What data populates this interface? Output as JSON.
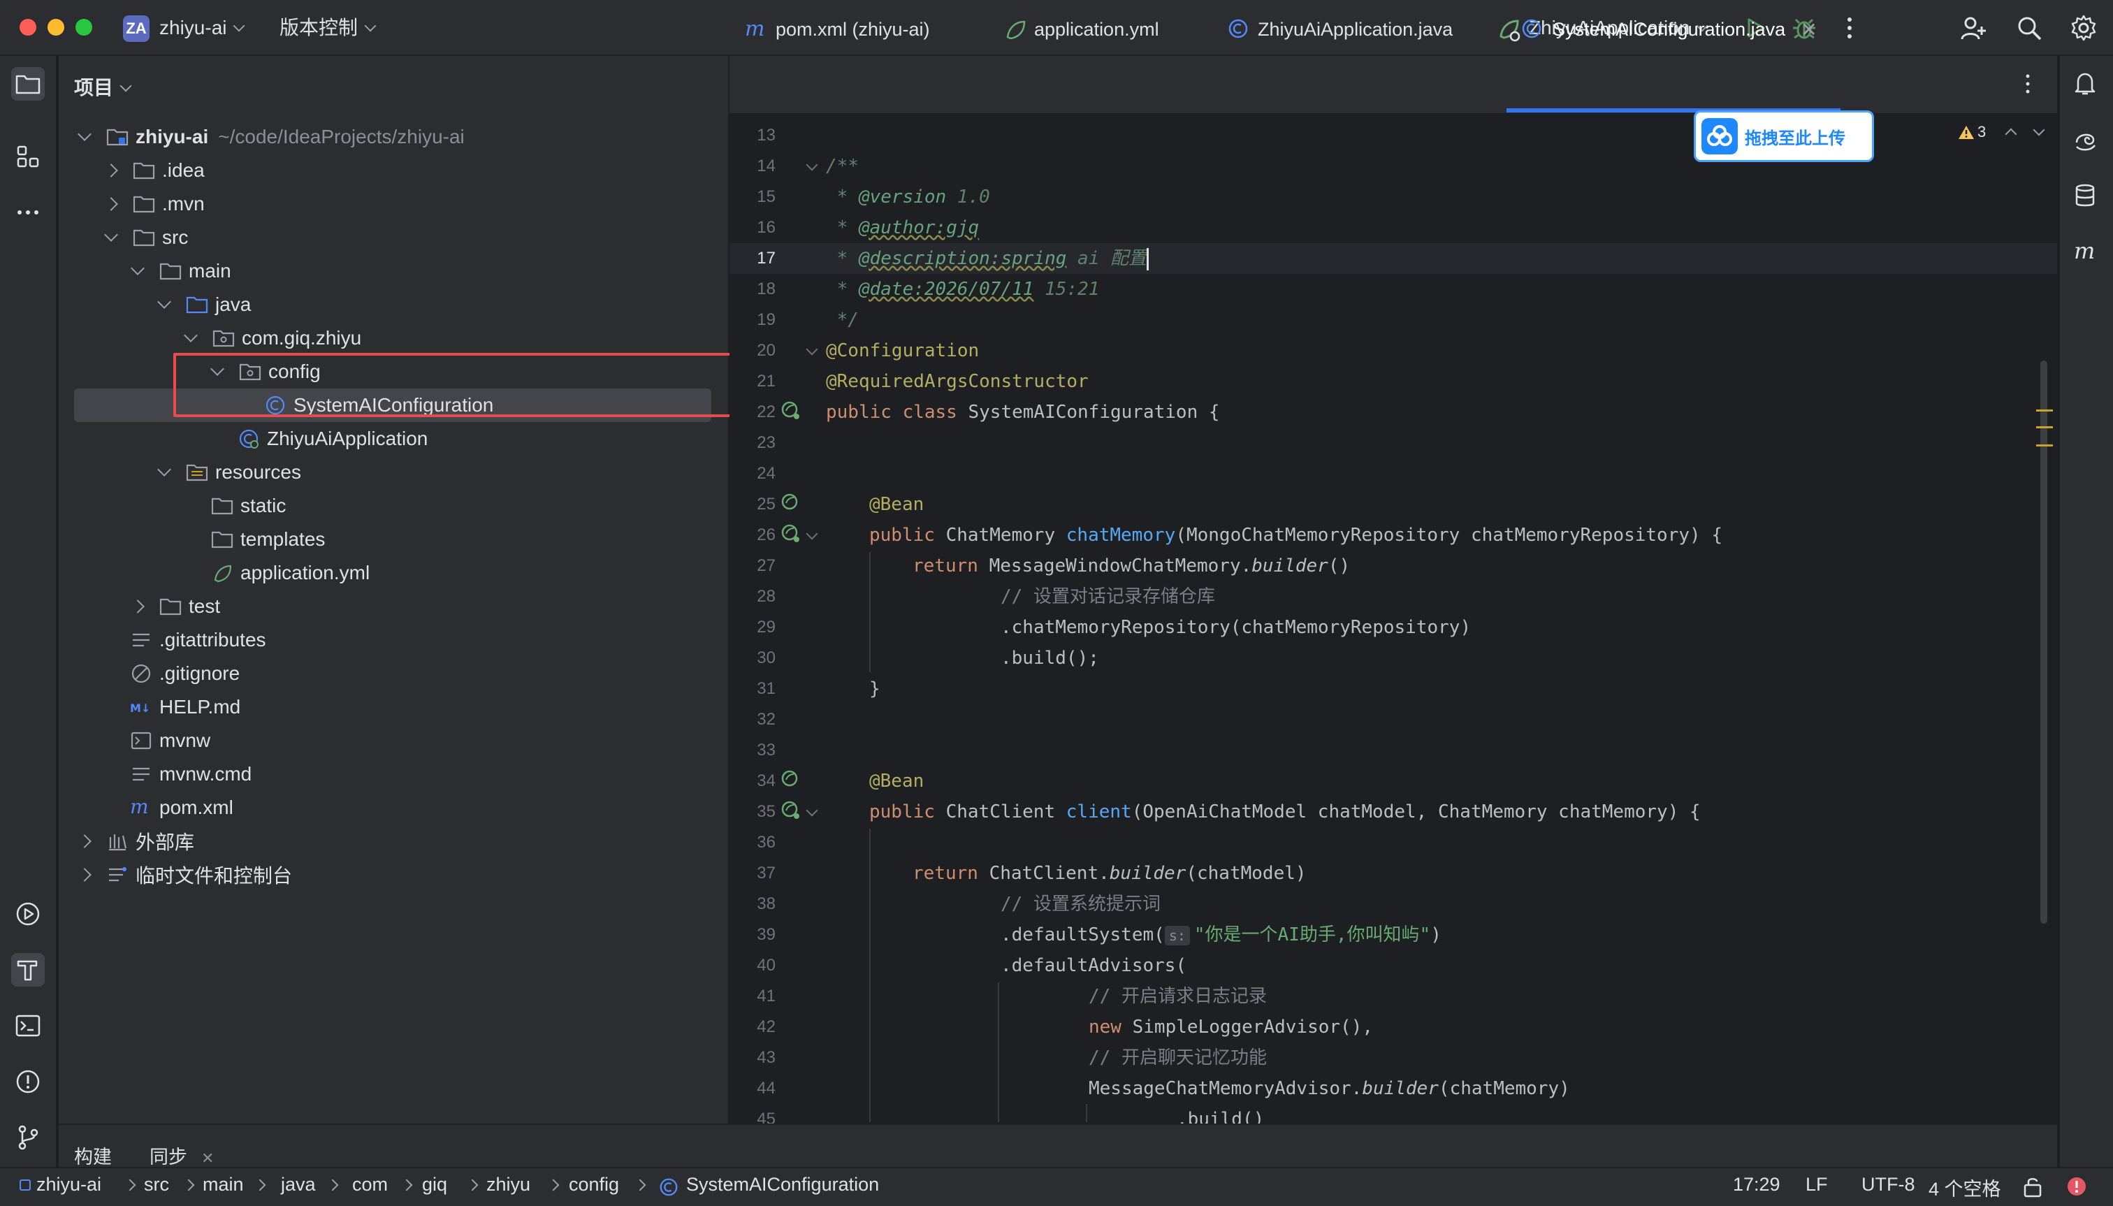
{
  "titlebar": {
    "project_badge": "ZA",
    "project_name": "zhiyu-ai",
    "vcs_menu": "版本控制",
    "run_config": "ZhiyuAiApplication"
  },
  "project_panel": {
    "title": "项目",
    "root_name": "zhiyu-ai",
    "root_path": "~/code/IdeaProjects/zhiyu-ai",
    "items": {
      "idea": ".idea",
      "mvn": ".mvn",
      "src": "src",
      "main": "main",
      "java": "java",
      "package": "com.giq.zhiyu",
      "config": "config",
      "sysconf": "SystemAIConfiguration",
      "app": "ZhiyuAiApplication",
      "resources": "resources",
      "static": "static",
      "templates": "templates",
      "appyml": "application.yml",
      "test": "test",
      "gitattributes": ".gitattributes",
      "gitignore": ".gitignore",
      "helpmd": "HELP.md",
      "mvnw": "mvnw",
      "mvnwcmd": "mvnw.cmd",
      "pom": "pom.xml",
      "extlib": "外部库",
      "scratch": "临时文件和控制台"
    }
  },
  "tabs": [
    {
      "label": "pom.xml (zhiyu-ai)"
    },
    {
      "label": "application.yml"
    },
    {
      "label": "ZhiyuAiApplication.java"
    },
    {
      "label": "SystemAIConfiguration.java"
    }
  ],
  "editor": {
    "warning_count": "3",
    "upload_label": "拖拽至此上传",
    "line_numbers": [
      "13",
      "14",
      "15",
      "16",
      "17",
      "18",
      "19",
      "20",
      "21",
      "22",
      "23",
      "24",
      "25",
      "26",
      "27",
      "28",
      "29",
      "30",
      "31",
      "32",
      "33",
      "34",
      "35",
      "36",
      "37",
      "38",
      "39",
      "40",
      "41",
      "42",
      "43",
      "44",
      "45"
    ],
    "code": {
      "l14": "/**",
      "l15a": " * ",
      "l15b": "@version",
      "l15c": " 1.0",
      "l16a": " * ",
      "l16b": "@author:gjq",
      "l17a": " * ",
      "l17b": "@description:spring",
      "l17c": " ai 配置",
      "l18a": " * ",
      "l18b": "@date:2026/07/11",
      "l18c": " 15:21",
      "l19": " */",
      "l20": "@Configuration",
      "l21": "@RequiredArgsConstructor",
      "l22a": "public class ",
      "l22b": "SystemAIConfiguration {",
      "l25": "@Bean",
      "l26a": "public ",
      "l26b": "ChatMemory ",
      "l26c": "chatMemory",
      "l26d": "(MongoChatMemoryRepository chatMemoryRepository) {",
      "l27a": "return ",
      "l27b": "MessageWindowChatMemory.",
      "l27c": "builder",
      "l27d": "()",
      "l28": "// 设置对话记录存储仓库",
      "l29": ".chatMemoryRepository(chatMemoryRepository)",
      "l30": ".build();",
      "l31": "}",
      "l34": "@Bean",
      "l35a": "public ",
      "l35b": "ChatClient ",
      "l35c": "client",
      "l35d": "(OpenAiChatModel chatModel, ChatMemory chatMemory) {",
      "l37a": "return ",
      "l37b": "ChatClient.",
      "l37c": "builder",
      "l37d": "(chatModel)",
      "l38": "// 设置系统提示词",
      "l39a": ".defaultSystem(",
      "l39hint": "s:",
      "l39b": "\"你是一个AI助手,你叫知屿\"",
      "l39c": ")",
      "l40": ".defaultAdvisors(",
      "l41": "// 开启请求日志记录",
      "l42a": "new ",
      "l42b": "SimpleLoggerAdvisor(),",
      "l43": "// 开启聊天记忆功能",
      "l44a": "MessageChatMemoryAdvisor.",
      "l44b": "builder",
      "l44c": "(chatMemory)",
      "l45": ".build()"
    }
  },
  "bottom_tabs": {
    "build": "构建",
    "sync": "同步"
  },
  "breadcrumb": [
    "zhiyu-ai",
    "src",
    "main",
    "java",
    "com",
    "giq",
    "zhiyu",
    "config",
    "SystemAIConfiguration"
  ],
  "status": {
    "position": "17:29",
    "line_sep": "LF",
    "encoding": "UTF-8",
    "indent": "4 个空格"
  }
}
